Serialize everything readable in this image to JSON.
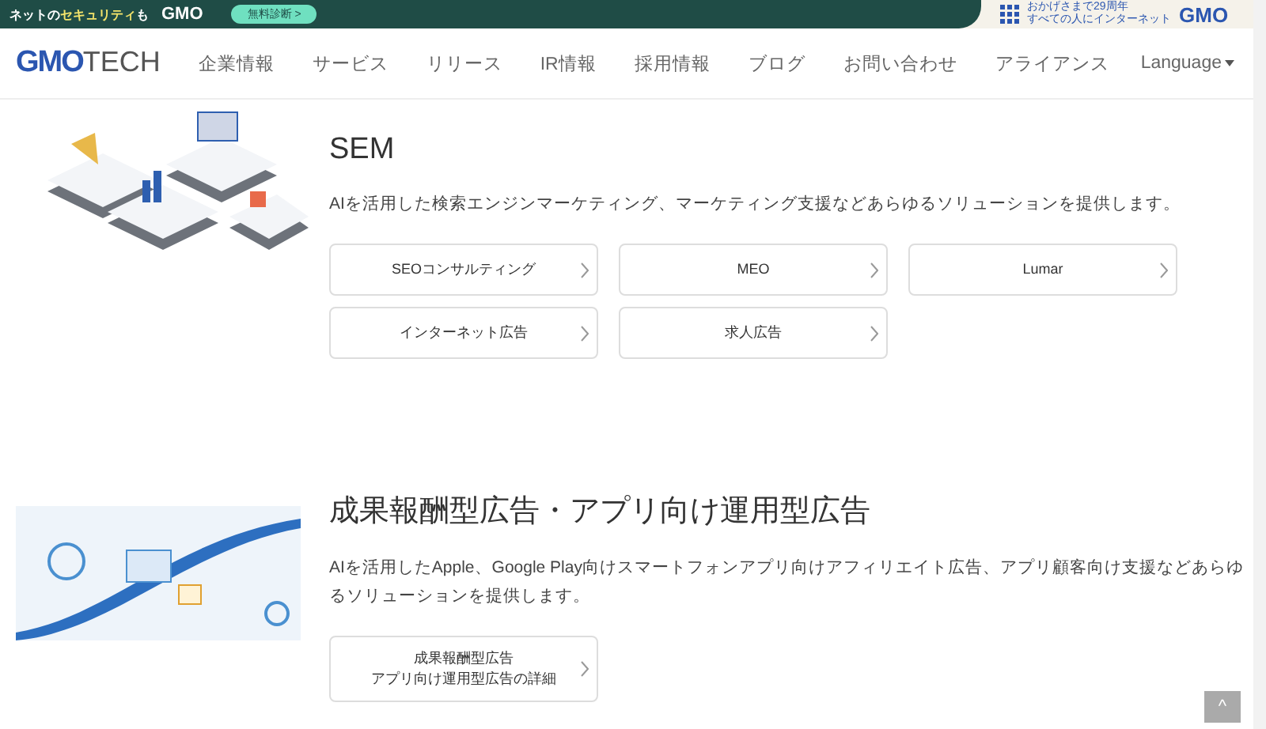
{
  "top_banner": {
    "text_before": "ネットの",
    "highlight": "セキュリティ",
    "text_after": "も",
    "brand": "GMO",
    "button": "無料診断 >",
    "tagline_1": "おかげさまで29周年",
    "tagline_2": "すべての人にインターネット",
    "right_brand": "GMO"
  },
  "header": {
    "logo_main": "GMO",
    "logo_sub": "TECH",
    "nav": [
      "企業情報",
      "サービス",
      "リリース",
      "IR情報",
      "採用情報",
      "ブログ",
      "お問い合わせ",
      "アライアンス"
    ],
    "language": "Language"
  },
  "sections": [
    {
      "kind": "sem",
      "title": "SEM",
      "description": "AIを活用した検索エンジンマーケティング、マーケティング支援などあらゆるソリューションを提供します。",
      "links": [
        {
          "lines": [
            "SEOコンサルティング"
          ]
        },
        {
          "lines": [
            "MEO"
          ]
        },
        {
          "lines": [
            "Lumar"
          ]
        },
        {
          "lines": [
            "インターネット広告"
          ]
        },
        {
          "lines": [
            "求人広告"
          ]
        }
      ]
    },
    {
      "kind": "app",
      "title": "成果報酬型広告・アプリ向け運用型広告",
      "description": "AIを活用したApple、Google Play向けスマートフォンアプリ向けアフィリエイト広告、アプリ顧客向け支援などあらゆるソリューションを提供します。",
      "links": [
        {
          "lines": [
            "成果報酬型広告",
            "アプリ向け運用型広告の詳細"
          ]
        }
      ]
    }
  ],
  "back_to_top": "^"
}
